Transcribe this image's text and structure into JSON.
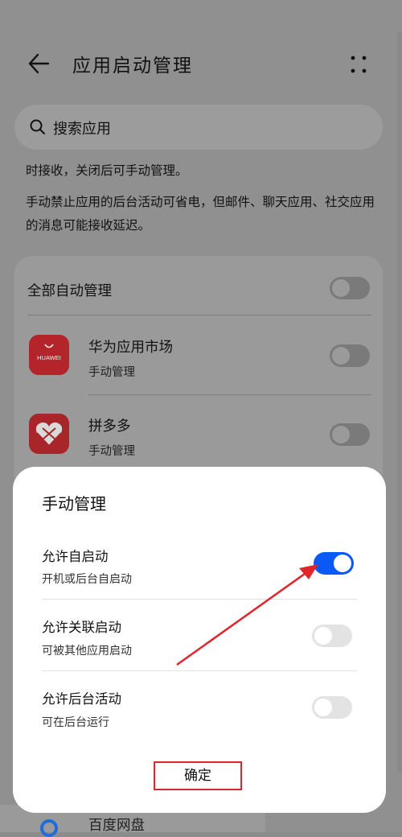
{
  "header": {
    "title": "应用启动管理"
  },
  "search": {
    "placeholder": "搜索应用"
  },
  "description": {
    "line1": "时接收，关闭后可手动管理。",
    "line2": "手动禁止应用的后台活动可省电，但邮件、聊天应用、社交应用的消息可能接收延迟。"
  },
  "list": {
    "all_auto": "全部自动管理",
    "apps": [
      {
        "name": "华为应用市场",
        "status": "手动管理",
        "icon_text": "HUAWEI"
      },
      {
        "name": "拼多多",
        "status": "手动管理"
      }
    ],
    "peek_app": "百度网盘"
  },
  "dialog": {
    "title": "手动管理",
    "options": [
      {
        "label": "允许自启动",
        "sub": "开机或后台自启动",
        "enabled": true
      },
      {
        "label": "允许关联启动",
        "sub": "可被其他应用启动",
        "enabled": false
      },
      {
        "label": "允许后台活动",
        "sub": "可在后台运行",
        "enabled": false
      }
    ],
    "confirm": "确定"
  },
  "colors": {
    "accent": "#0a59f7",
    "highlight": "#e0262a"
  }
}
